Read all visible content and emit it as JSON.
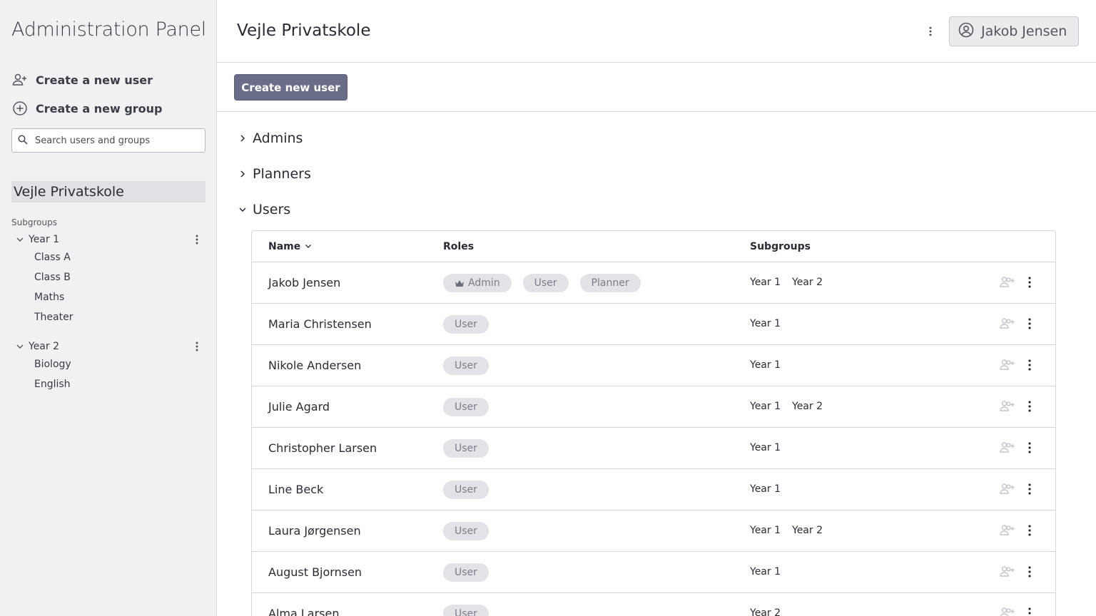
{
  "sidebar": {
    "app_title": "Administration Panel",
    "actions": [
      {
        "label": "Create a new user",
        "icon": "person-add-icon"
      },
      {
        "label": "Create a new group",
        "icon": "plus-circle-icon"
      }
    ],
    "search": {
      "placeholder": "Search users and groups",
      "value": ""
    },
    "organization": "Vejle Privatskole",
    "subgroups_label": "Subgroups",
    "groups": [
      {
        "label": "Year 1",
        "expanded": true,
        "children": [
          "Class A",
          "Class B",
          "Maths",
          "Theater"
        ]
      },
      {
        "label": "Year 2",
        "expanded": true,
        "children": [
          "Biology",
          "English"
        ]
      }
    ]
  },
  "header": {
    "title": "Vejle Privatskole",
    "user_name": "Jakob Jensen"
  },
  "toolbar": {
    "create_user_label": "Create new user"
  },
  "sections": [
    {
      "label": "Admins",
      "expanded": false
    },
    {
      "label": "Planners",
      "expanded": false
    },
    {
      "label": "Users",
      "expanded": true
    }
  ],
  "users_table": {
    "columns": {
      "name": "Name",
      "roles": "Roles",
      "subgroups": "Subgroups"
    },
    "rows": [
      {
        "name": "Jakob Jensen",
        "roles": [
          "Admin",
          "User",
          "Planner"
        ],
        "subgroups": [
          "Year 1",
          "Year 2"
        ]
      },
      {
        "name": "Maria Christensen",
        "roles": [
          "User"
        ],
        "subgroups": [
          "Year 1"
        ]
      },
      {
        "name": "Nikole Andersen",
        "roles": [
          "User"
        ],
        "subgroups": [
          "Year 1"
        ]
      },
      {
        "name": "Julie Agard",
        "roles": [
          "User"
        ],
        "subgroups": [
          "Year 1",
          "Year 2"
        ]
      },
      {
        "name": "Christopher Larsen",
        "roles": [
          "User"
        ],
        "subgroups": [
          "Year 1"
        ]
      },
      {
        "name": "Line Beck",
        "roles": [
          "User"
        ],
        "subgroups": [
          "Year 1"
        ]
      },
      {
        "name": "Laura Jørgensen",
        "roles": [
          "User"
        ],
        "subgroups": [
          "Year 1",
          "Year 2"
        ]
      },
      {
        "name": "August Bjornsen",
        "roles": [
          "User"
        ],
        "subgroups": [
          "Year 1"
        ]
      },
      {
        "name": "Alma Larsen",
        "roles": [
          "User"
        ],
        "subgroups": [
          "Year 2"
        ]
      }
    ]
  },
  "colors": {
    "sidebar_bg": "#f1f1f3",
    "primary_button": "#6a6d87",
    "chip_bg": "#e2e2e7",
    "chip_text": "#7c7c86"
  }
}
